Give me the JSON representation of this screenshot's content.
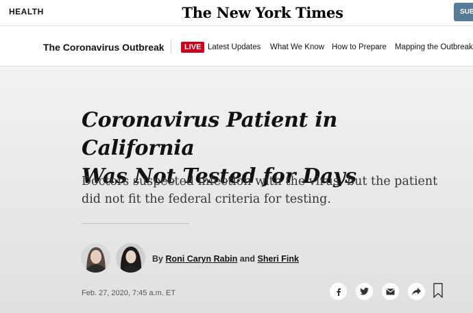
{
  "header": {
    "section": "HEALTH",
    "logo": "The New York Times",
    "subscribe": "SUB"
  },
  "subnav": {
    "topic": "The Coronavirus Outbreak",
    "live_badge": "LIVE",
    "links": [
      "Latest Updates",
      "What We Know",
      "How to Prepare",
      "Mapping the Outbreak"
    ]
  },
  "article": {
    "headline_line1": "Coronavirus Patient in California",
    "headline_line2": "Was Not Tested for Days",
    "summary": "Doctors suspected infection with the virus, but the patient did not fit the federal criteria for testing.",
    "byline_prefix": "By",
    "author1": "Roni Caryn Rabin",
    "byline_and": "and",
    "author2": "Sheri Fink",
    "date": "Feb. 27, 2020, 7:45 a.m. ET"
  },
  "share": {
    "icons": [
      "facebook-icon",
      "twitter-icon",
      "email-icon",
      "share-icon",
      "bookmark-icon"
    ]
  },
  "colors": {
    "live_red": "#d0021b",
    "subscribe_blue": "#567b95"
  }
}
